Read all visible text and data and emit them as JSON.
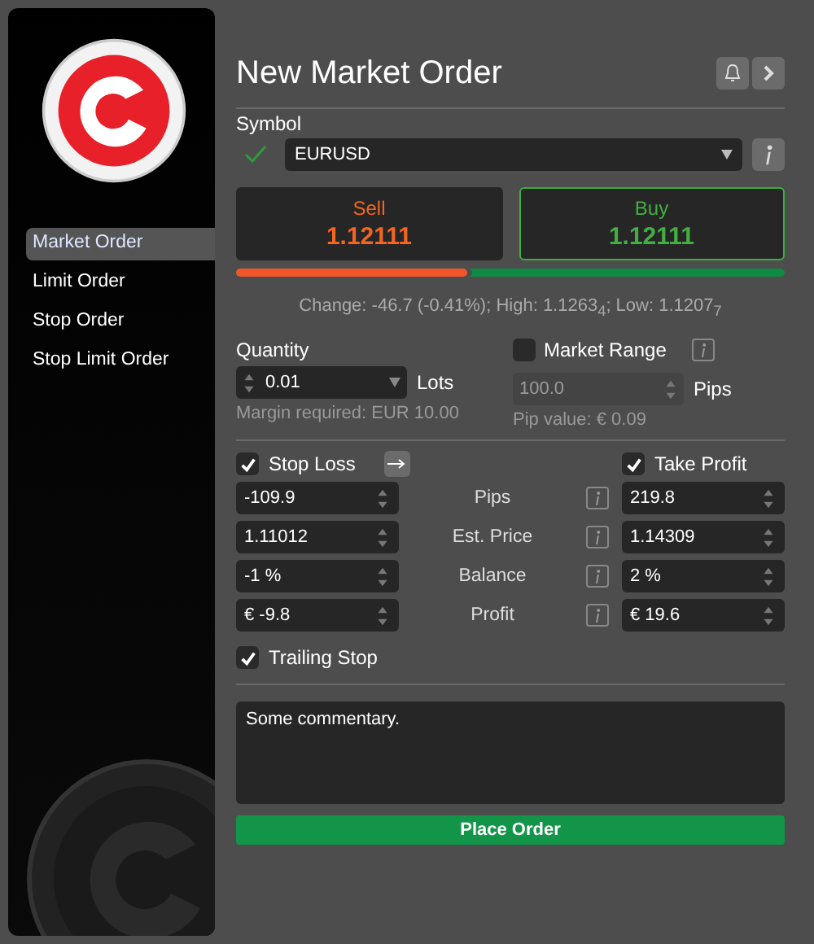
{
  "sidebar": {
    "items": [
      {
        "label": "Market Order",
        "selected": true
      },
      {
        "label": "Limit Order",
        "selected": false
      },
      {
        "label": "Stop Order",
        "selected": false
      },
      {
        "label": "Stop Limit Order",
        "selected": false
      }
    ]
  },
  "title": "New Market Order",
  "symbol": {
    "label": "Symbol",
    "valid": true,
    "value": "EURUSD"
  },
  "sell": {
    "label": "Sell",
    "price": "1.12111",
    "selected": false
  },
  "buy": {
    "label": "Buy",
    "price": "1.12111",
    "selected": true
  },
  "sentiment": {
    "level": 0.42
  },
  "stats": "Change: -46.7 (-0.41%); High: 1.1263$_{4}$; Low: 1.1207$_{7}$",
  "quantity": {
    "label": "Quantity",
    "value": "0.01",
    "unit": "Lots",
    "note": "Margin required: EUR 10.00"
  },
  "market_range": {
    "label": "Market Range",
    "checked": false,
    "value": "100.0",
    "unit": "Pips",
    "note": "Pip value: € 0.09"
  },
  "stop_loss": {
    "label": "Stop Loss",
    "checked": true
  },
  "take_profit": {
    "label": "Take Profit",
    "checked": true
  },
  "rows": [
    {
      "label": "Pips",
      "stop_loss": "-109.9",
      "take_profit": "219.8"
    },
    {
      "label": "Est. Price",
      "stop_loss": "1.11012",
      "take_profit": "1.14309"
    },
    {
      "label": "Balance",
      "stop_loss": "-1 %",
      "take_profit": "2 %"
    },
    {
      "label": "Profit",
      "stop_loss": "€ -9.8",
      "take_profit": "€ 19.6"
    }
  ],
  "trailing_stop": {
    "label": "Trailing Stop",
    "checked": true
  },
  "comment": {
    "value": "Some commentary."
  },
  "submit": "Place Order"
}
